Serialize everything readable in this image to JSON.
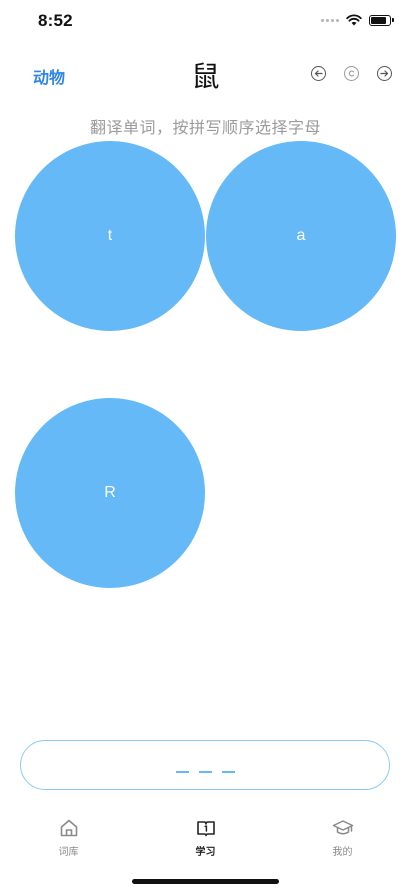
{
  "status_bar": {
    "time": "8:52",
    "battery_level": 0.85
  },
  "nav": {
    "category": "动物",
    "word": "鼠",
    "icons": [
      "arrow-left-circle-icon",
      "copyright-circle-icon",
      "arrow-right-circle-icon"
    ]
  },
  "instruction": "翻译单词，按拼写顺序选择字母",
  "letters": [
    "t",
    "a",
    "R"
  ],
  "answer": {
    "slots": 3
  },
  "tabs": [
    {
      "label": "词库",
      "icon": "home-icon",
      "active": false
    },
    {
      "label": "学习",
      "icon": "book-icon",
      "active": true
    },
    {
      "label": "我的",
      "icon": "graduation-cap-icon",
      "active": false
    }
  ],
  "colors": {
    "accent": "#2f86e6",
    "bubble": "#64b9f6",
    "answer_border": "#8ccaf6",
    "instruction": "#9b9b9b"
  }
}
